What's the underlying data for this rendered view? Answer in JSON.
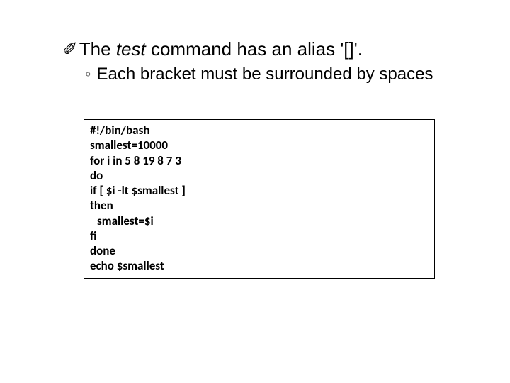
{
  "heading": {
    "bullet": "✐",
    "pre": "The ",
    "cmd": "test",
    "post": " command has an alias '[]'."
  },
  "sub": {
    "bullet": "◦",
    "text": "Each bracket must be surrounded by spaces"
  },
  "code": {
    "l1": "#!/bin/bash",
    "l2": "smallest=10000",
    "l3": "for i in 5 8 19 8 7 3",
    "l4": "do",
    "l5": "if [ $i -lt $smallest ]",
    "l6": "then",
    "l7": "smallest=$i",
    "l8": "fi",
    "l9": "done",
    "l10": "echo $smallest"
  }
}
